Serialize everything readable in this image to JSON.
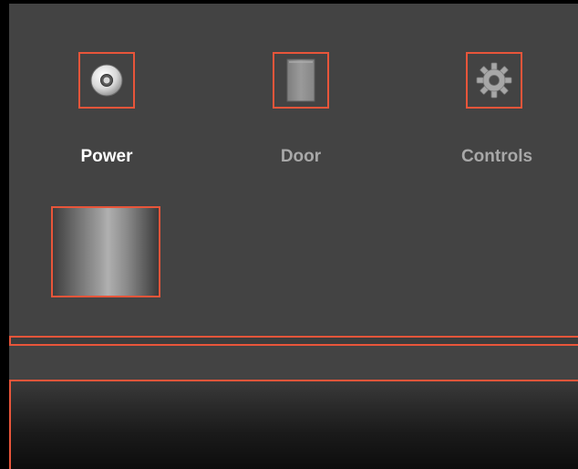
{
  "controls": [
    {
      "id": "power",
      "label": "Power",
      "icon": "power-disc-icon",
      "active": true
    },
    {
      "id": "door",
      "label": "Door",
      "icon": "door-icon",
      "active": false
    },
    {
      "id": "controls",
      "label": "Controls",
      "icon": "gear-icon",
      "active": false
    }
  ],
  "colors": {
    "panel": "#434343",
    "highlight": "#e8553a",
    "label_active": "#ffffff",
    "label_inactive": "#a8a8a8"
  }
}
